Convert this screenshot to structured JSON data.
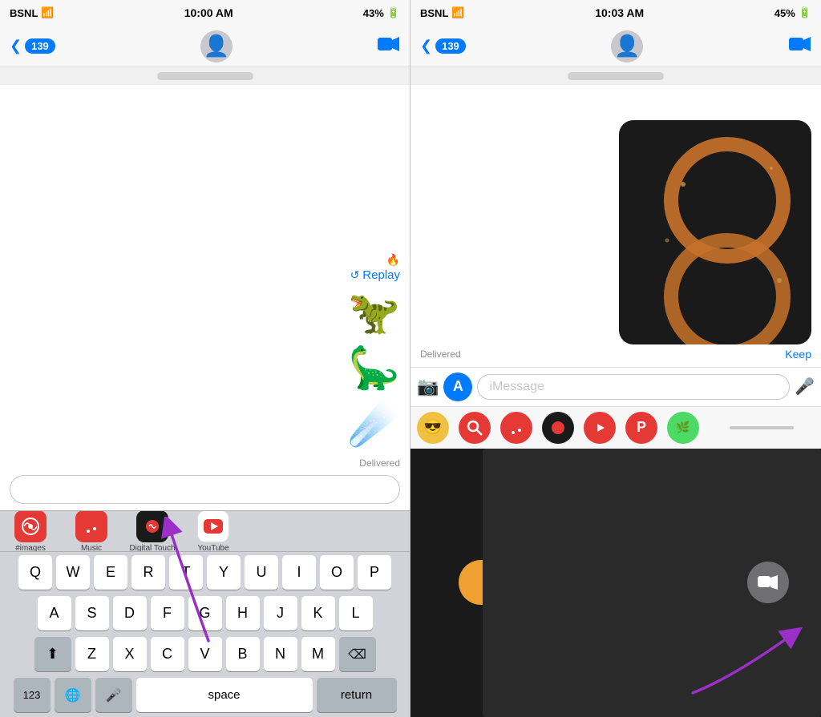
{
  "left_panel": {
    "status": {
      "carrier": "BSNL",
      "time": "10:00 AM",
      "battery": "43%"
    },
    "nav": {
      "back_count": "139",
      "video_icon": "📹"
    },
    "messages": {
      "replay_label": "Replay",
      "delivered_label": "Delivered"
    },
    "tray": {
      "apps": [
        {
          "id": "images",
          "label": "#images",
          "color": "#e53935"
        },
        {
          "id": "music",
          "label": "Music",
          "color": "#e53935"
        },
        {
          "id": "digital-touch",
          "label": "Digital Touch",
          "color": "#1a1a1a"
        },
        {
          "id": "youtube",
          "label": "YouTube",
          "color": "white"
        }
      ]
    },
    "keyboard": {
      "rows": [
        [
          "Q",
          "W",
          "E",
          "R",
          "T",
          "Y",
          "U",
          "I",
          "O",
          "P"
        ],
        [
          "A",
          "S",
          "D",
          "F",
          "G",
          "H",
          "J",
          "K",
          "L"
        ],
        [
          "Z",
          "X",
          "C",
          "V",
          "B",
          "N",
          "M"
        ]
      ],
      "space_label": "space",
      "return_label": "return",
      "num_label": "123"
    }
  },
  "right_panel": {
    "status": {
      "carrier": "BSNL",
      "time": "10:03 AM",
      "battery": "45%"
    },
    "nav": {
      "back_count": "139"
    },
    "messages": {
      "delivered_label": "Delivered",
      "keep_label": "Keep"
    },
    "input": {
      "placeholder": "iMessage"
    },
    "digital_touch": {
      "hint": "Digital Touch drawing area"
    }
  }
}
